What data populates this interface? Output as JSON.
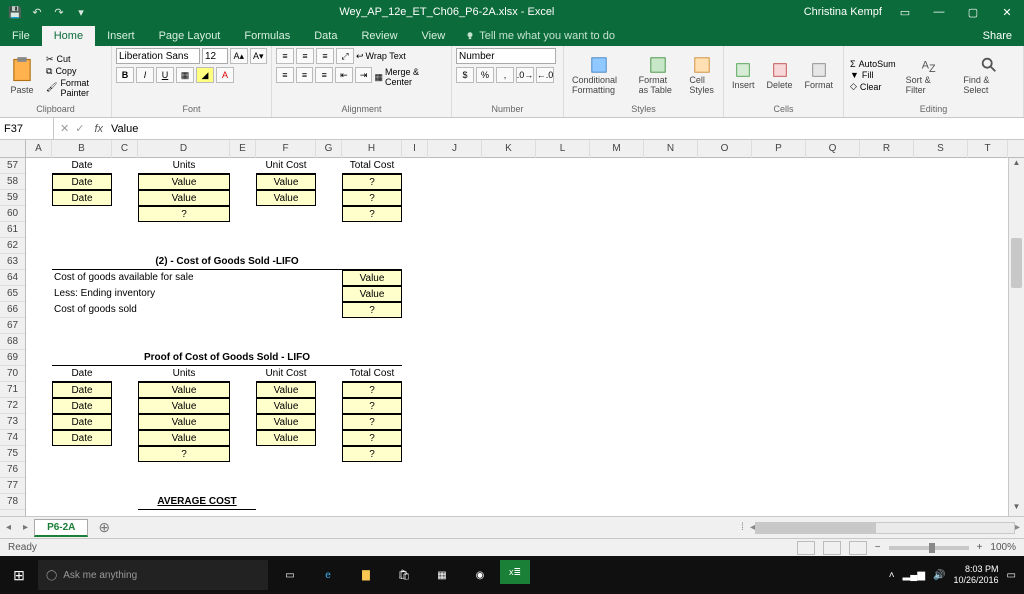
{
  "title": "Wey_AP_12e_ET_Ch06_P6-2A.xlsx - Excel",
  "user": "Christina Kempf",
  "tabs": [
    "File",
    "Home",
    "Insert",
    "Page Layout",
    "Formulas",
    "Data",
    "Review",
    "View"
  ],
  "tell": "Tell me what you want to do",
  "share": "Share",
  "ribbon": {
    "clipboard": {
      "paste": "Paste",
      "cut": "Cut",
      "copy": "Copy",
      "painter": "Format Painter",
      "label": "Clipboard"
    },
    "font": {
      "name": "Liberation Sans",
      "size": "12",
      "label": "Font"
    },
    "alignment": {
      "wrap": "Wrap Text",
      "merge": "Merge & Center",
      "label": "Alignment"
    },
    "number": {
      "format": "Number",
      "label": "Number"
    },
    "styles": {
      "cond": "Conditional Formatting",
      "table": "Format as Table",
      "cell": "Cell Styles",
      "label": "Styles"
    },
    "cells": {
      "insert": "Insert",
      "delete": "Delete",
      "format": "Format",
      "label": "Cells"
    },
    "editing": {
      "autosum": "AutoSum",
      "fill": "Fill",
      "clear": "Clear",
      "sort": "Sort & Filter",
      "find": "Find & Select",
      "label": "Editing"
    }
  },
  "namebox": "F37",
  "formula": "Value",
  "columns": [
    "A",
    "B",
    "C",
    "D",
    "E",
    "F",
    "G",
    "H",
    "I",
    "J",
    "K",
    "L",
    "M",
    "N",
    "O",
    "P",
    "Q",
    "R",
    "S",
    "T"
  ],
  "rows_start": 57,
  "rows_end": 78,
  "sections": {
    "row57": {
      "B": "Date",
      "D": "Units",
      "F": "Unit Cost",
      "H": "Total Cost"
    },
    "row58": {
      "B": "Date",
      "D": "Value",
      "F": "Value",
      "H": "?"
    },
    "row59": {
      "B": "Date",
      "D": "Value",
      "F": "Value",
      "H": "?"
    },
    "row60": {
      "D": "?",
      "H": "?"
    },
    "row63_title": "(2) - Cost of Goods Sold -LIFO",
    "row64": {
      "label": "Cost of goods available for sale",
      "H": "Value"
    },
    "row65": {
      "label": "Less: Ending inventory",
      "H": "Value"
    },
    "row66": {
      "label": "Cost of goods sold",
      "H": "?"
    },
    "row69_title": "Proof of Cost of Goods Sold - LIFO",
    "row70": {
      "B": "Date",
      "D": "Units",
      "F": "Unit Cost",
      "H": "Total Cost"
    },
    "row71": {
      "B": "Date",
      "D": "Value",
      "F": "Value",
      "H": "?"
    },
    "row72": {
      "B": "Date",
      "D": "Value",
      "F": "Value",
      "H": "?"
    },
    "row73": {
      "B": "Date",
      "D": "Value",
      "F": "Value",
      "H": "?"
    },
    "row74": {
      "B": "Date",
      "D": "Value",
      "F": "Value",
      "H": "?"
    },
    "row75": {
      "D": "?",
      "H": "?"
    },
    "row78": "AVERAGE COST"
  },
  "sheet": "P6-2A",
  "status": {
    "ready": "Ready",
    "zoom": "100%"
  },
  "taskbar": {
    "search": "Ask me anything",
    "time": "8:03 PM",
    "date": "10/26/2016"
  }
}
